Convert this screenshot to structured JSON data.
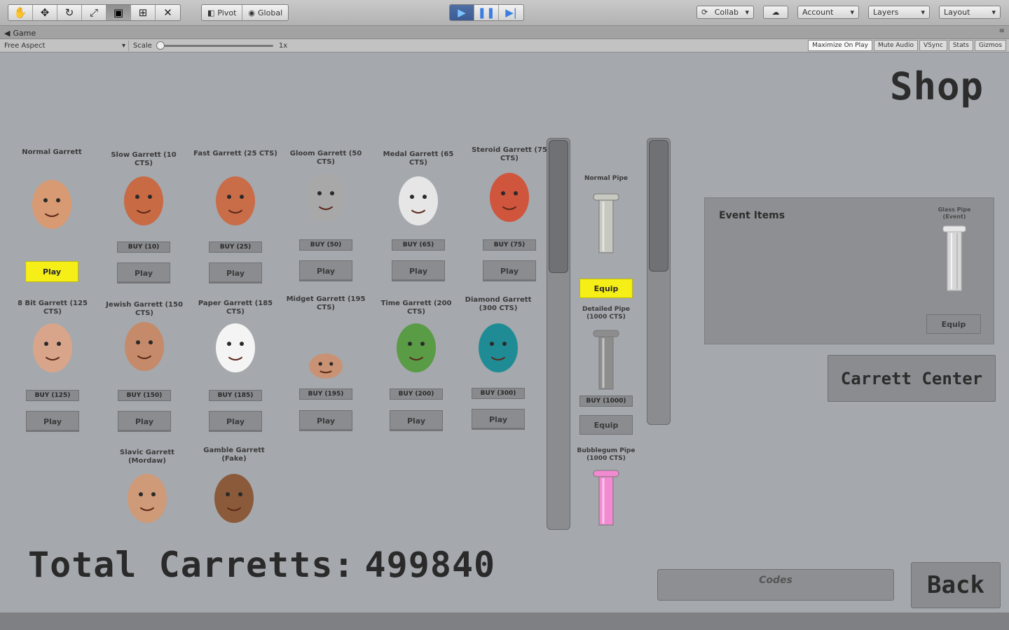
{
  "toolbar": {
    "tools": [
      "hand-tool-icon",
      "move-tool-icon",
      "rotate-tool-icon",
      "scale-tool-icon",
      "rect-tool-icon",
      "transform-tool-icon",
      "custom-tool-icon"
    ],
    "pivot_label": "Pivot",
    "global_label": "Global",
    "collab_label": "Collab",
    "account_label": "Account",
    "layers_label": "Layers",
    "layout_label": "Layout"
  },
  "tab": {
    "label": "Game"
  },
  "game_options": {
    "aspect_label": "Free Aspect",
    "scale_label": "Scale",
    "scale_value": "1x",
    "maximize_label": "Maximize On Play",
    "mute_label": "Mute Audio",
    "vsync_label": "VSync",
    "stats_label": "Stats",
    "gizmos_label": "Gizmos"
  },
  "shop": {
    "title": "Shop",
    "characters": [
      {
        "name": "Normal Garrett",
        "play": "Play",
        "active": true,
        "face": "#d89a72"
      },
      {
        "name": "Slow Garrett (10 CTS)",
        "buy": "BUY (10)",
        "play": "Play",
        "face": "#c86a44"
      },
      {
        "name": "Fast Garrett (25 CTS)",
        "buy": "BUY (25)",
        "play": "Play",
        "face": "#c96c48"
      },
      {
        "name": "Gloom Garrett (50 CTS)",
        "buy": "BUY (50)",
        "play": "Play",
        "face": "#a8a8a8"
      },
      {
        "name": "Medal Garrett (65 CTS)",
        "buy": "BUY (65)",
        "play": "Play",
        "face": "#e6e6e6"
      },
      {
        "name": "Steroid Garrett (75 CTS)",
        "buy": "BUY (75)",
        "play": "Play",
        "face": "#d0553d"
      },
      {
        "name": "8 Bit Garrett (125 CTS)",
        "buy": "BUY (125)",
        "play": "Play",
        "face": "#d9a58a"
      },
      {
        "name": "Jewish Garrett (150 CTS)",
        "buy": "BUY (150)",
        "play": "Play",
        "face": "#c58a6a"
      },
      {
        "name": "Paper Garrett (185 CTS)",
        "buy": "BUY (185)",
        "play": "Play",
        "face": "#f4f4f4"
      },
      {
        "name": "Midget Garrett (195 CTS)",
        "buy": "BUY (195)",
        "play": "Play",
        "face": "#c99274"
      },
      {
        "name": "Time Garrett (200 CTS)",
        "buy": "BUY (200)",
        "play": "Play",
        "face": "#5a9b45"
      },
      {
        "name": "Diamond Garrett (300 CTS)",
        "buy": "BUY (300)",
        "play": "Play",
        "face": "#1f8c95"
      },
      {
        "name": "Slavic Garrett (Mordaw)",
        "face": "#cf9a78"
      },
      {
        "name": "Gamble Garrett (Fake)",
        "face": "#8a5a3a"
      }
    ]
  },
  "pipes": [
    {
      "name": "Normal Pipe",
      "equip": "Equip",
      "active": true,
      "color": "#c7c8bf"
    },
    {
      "name": "Detailed Pipe (1000 CTS)",
      "buy": "BUY (1000)",
      "equip": "Equip",
      "color": "#8d8d8d"
    },
    {
      "name": "Bubblegum Pipe (1000 CTS)",
      "color": "#f28ad2"
    }
  ],
  "event": {
    "title": "Event Items",
    "item_name": "Glass Pipe (Event)",
    "equip": "Equip"
  },
  "carrett_center": "Carrett Center",
  "total": {
    "label": "Total Carretts:",
    "value": "499840"
  },
  "codes_placeholder": "Codes",
  "back_label": "Back"
}
